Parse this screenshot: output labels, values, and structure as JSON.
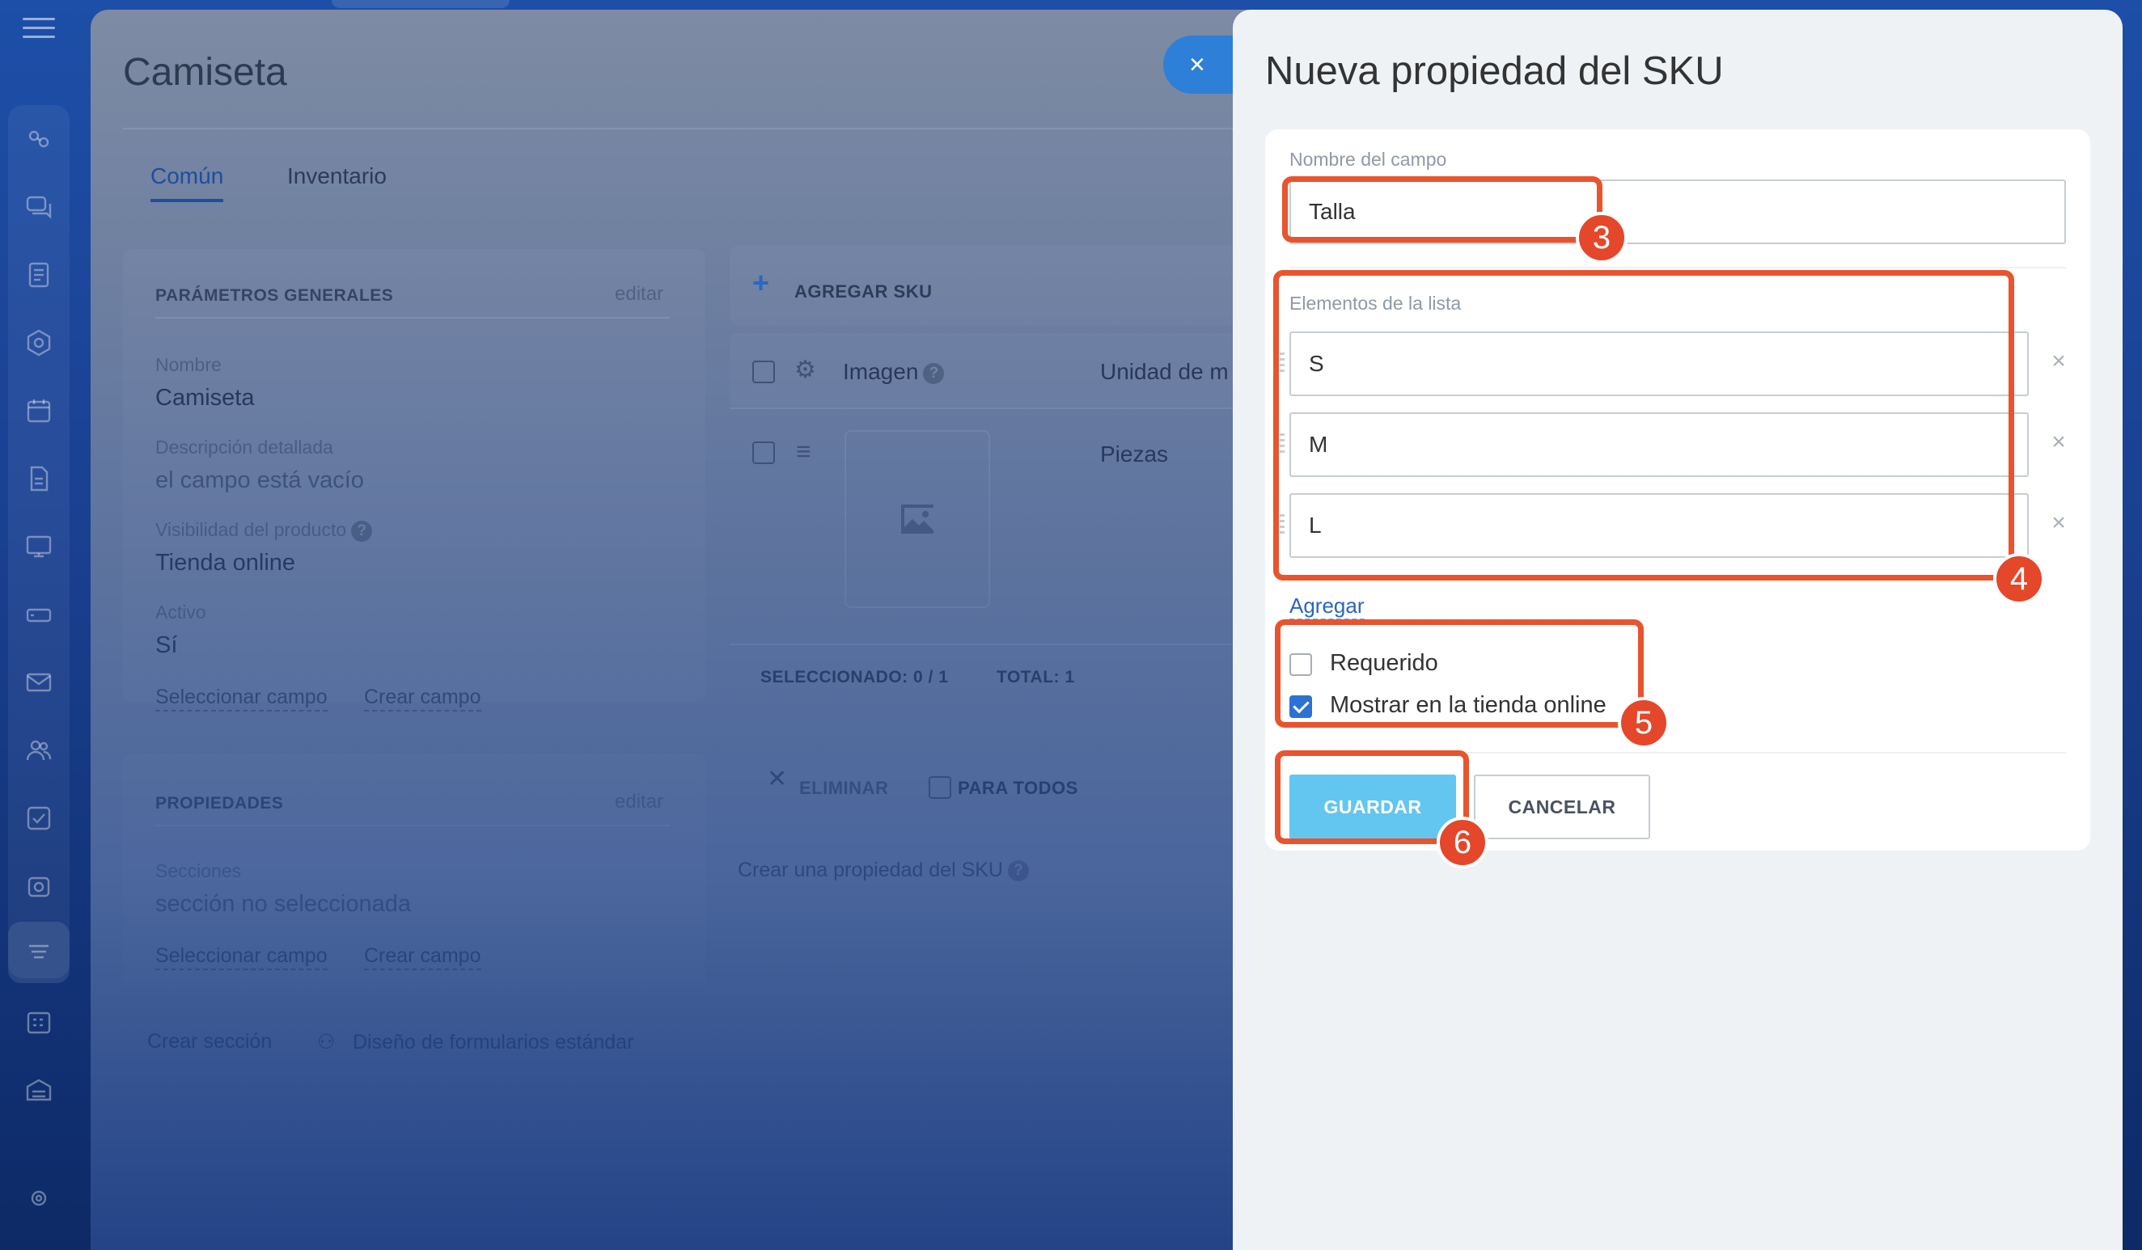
{
  "product": {
    "title": "Camiseta",
    "tabs": [
      "Común",
      "Inventario"
    ],
    "general": {
      "heading": "PARÁMETROS GENERALES",
      "edit": "editar",
      "fields": [
        {
          "label": "Nombre",
          "value": "Camiseta"
        },
        {
          "label": "Descripción detallada",
          "value": "el campo está vacío"
        },
        {
          "label": "Visibilidad del producto",
          "value": "Tienda online"
        },
        {
          "label": "Activo",
          "value": "Sí"
        }
      ],
      "select_field": "Seleccionar campo",
      "create_field": "Crear campo"
    },
    "properties": {
      "heading": "PROPIEDADES",
      "edit": "editar",
      "label": "Secciones",
      "value": "sección no seleccionada",
      "select_field": "Seleccionar campo",
      "create_field": "Crear campo"
    },
    "footer": {
      "create_section": "Crear sección",
      "form_design": "Diseño de formularios estándar"
    },
    "sku": {
      "add": "AGREGAR SKU",
      "col_image": "Imagen",
      "col_unit": "Unidad de m",
      "row_unit": "Piezas",
      "selected": "SELECCIONADO: 0 / 1",
      "total": "TOTAL: 1",
      "delete": "ELIMINAR",
      "for_all": "PARA TODOS",
      "create_property": "Crear una propiedad del SKU"
    }
  },
  "panel": {
    "title": "Nueva propiedad del SKU",
    "field_name_label": "Nombre del campo",
    "field_name_value": "Talla",
    "list_label": "Elementos de la lista",
    "list_items": [
      "S",
      "M",
      "L"
    ],
    "add_link": "Agregar",
    "required_label": "Requerido",
    "required_checked": false,
    "show_label": "Mostrar en la tienda online",
    "show_checked": true,
    "save": "GUARDAR",
    "cancel": "CANCELAR"
  },
  "callouts": [
    "3",
    "4",
    "5",
    "6"
  ],
  "colors": {
    "callout": "#e8542e",
    "save_button": "#63c6f0",
    "link": "#2a66c4",
    "checkbox": "#2c72d6"
  }
}
